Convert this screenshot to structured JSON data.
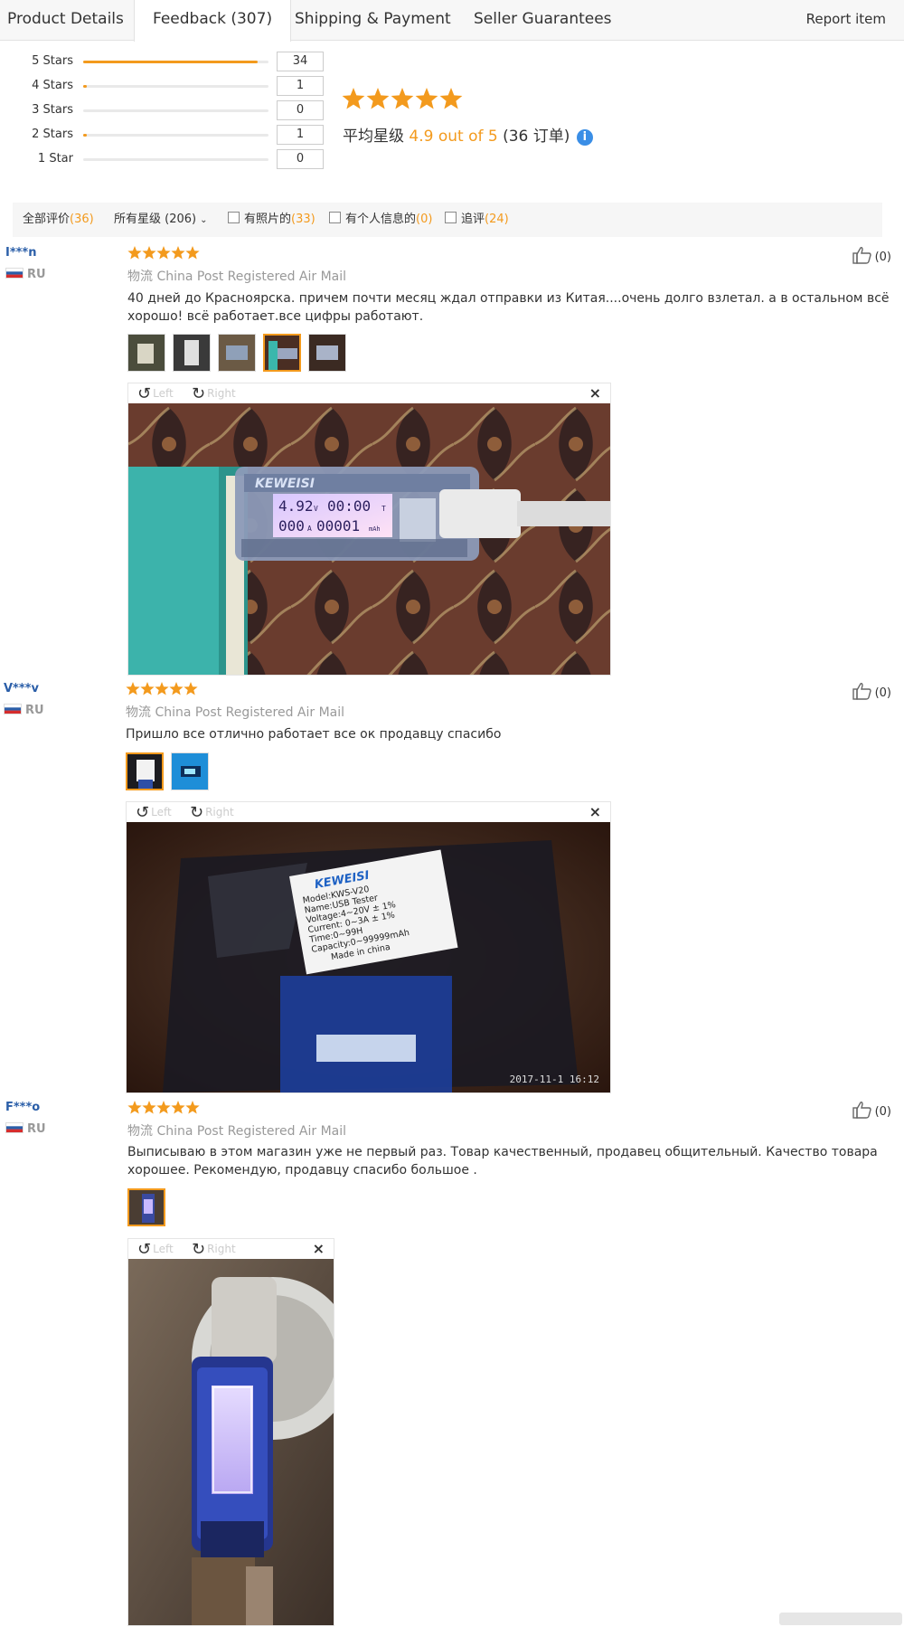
{
  "tabs": {
    "product_details": "Product Details",
    "feedback": "Feedback (307)",
    "shipping": "Shipping & Payment",
    "seller": "Seller Guarantees",
    "report": "Report item"
  },
  "rating_summary": {
    "rows": [
      {
        "label": "5 Stars",
        "count": "34",
        "fraction": 0.94
      },
      {
        "label": "4 Stars",
        "count": "1",
        "fraction": 0.02
      },
      {
        "label": "3 Stars",
        "count": "0",
        "fraction": 0
      },
      {
        "label": "2 Stars",
        "count": "1",
        "fraction": 0.02
      },
      {
        "label": "1 Star",
        "count": "0",
        "fraction": 0
      }
    ],
    "stars": 5,
    "avg_label": "平均星级",
    "avg_score": "4.9 out of 5",
    "order_open": "(36 订单)",
    "info_glyph": "i"
  },
  "filters": {
    "all_label": "全部评价",
    "all_count": "(36)",
    "star_select": "所有星级 (206)",
    "photos_label": "有照片的",
    "photos_count": "(33)",
    "personal_label": "有个人信息的",
    "personal_count": "(0)",
    "followup_label": "追评",
    "followup_count": "(24)"
  },
  "viewer": {
    "left": "Left",
    "right": "Right",
    "close": "×"
  },
  "reviews": [
    {
      "user": "I***n",
      "country": "RU",
      "shipping_label": "物流",
      "shipping": "China Post Registered Air Mail",
      "text": "40 дней до Красноярска. причем почти месяц ждал отправки из Китая....очень долго взлетал. а в остальном всё хорошо! всё работает.все цифры работают.",
      "helpful": "(0)",
      "stars": 5,
      "display_values": [
        "4.92",
        "V",
        "00:00",
        "T",
        "000",
        "A",
        "00001",
        "mAh"
      ],
      "brand": "KEWEISI"
    },
    {
      "user": "V***v",
      "country": "RU",
      "shipping_label": "物流",
      "shipping": "China Post Registered Air Mail",
      "text": "Пришло все отлично работает все ок продавцу спасибо",
      "helpful": "(0)",
      "stars": 5,
      "label_lines": [
        "KEWEISI",
        "Model:KWS-V20",
        "Name:USB Tester",
        "Voltage:4~20V ± 1%",
        "Current: 0~3A ± 1%",
        "Time:0~99H",
        "Capacity:0~99999mAh",
        "Made in china"
      ],
      "timestamp": "2017-11-1 16:12"
    },
    {
      "user": "F***o",
      "country": "RU",
      "shipping_label": "物流",
      "shipping": "China Post Registered Air Mail",
      "text": "Выписываю в этом магазин уже не первый раз. Товар качественный, продавец общительный. Качество товара хорошее. Рекомендую, продавцу спасибо большое .",
      "helpful": "(0)",
      "stars": 5
    }
  ],
  "colors": {
    "accent": "#f39a1d",
    "username": "#2a5ea8",
    "info": "#3a8ee6"
  }
}
